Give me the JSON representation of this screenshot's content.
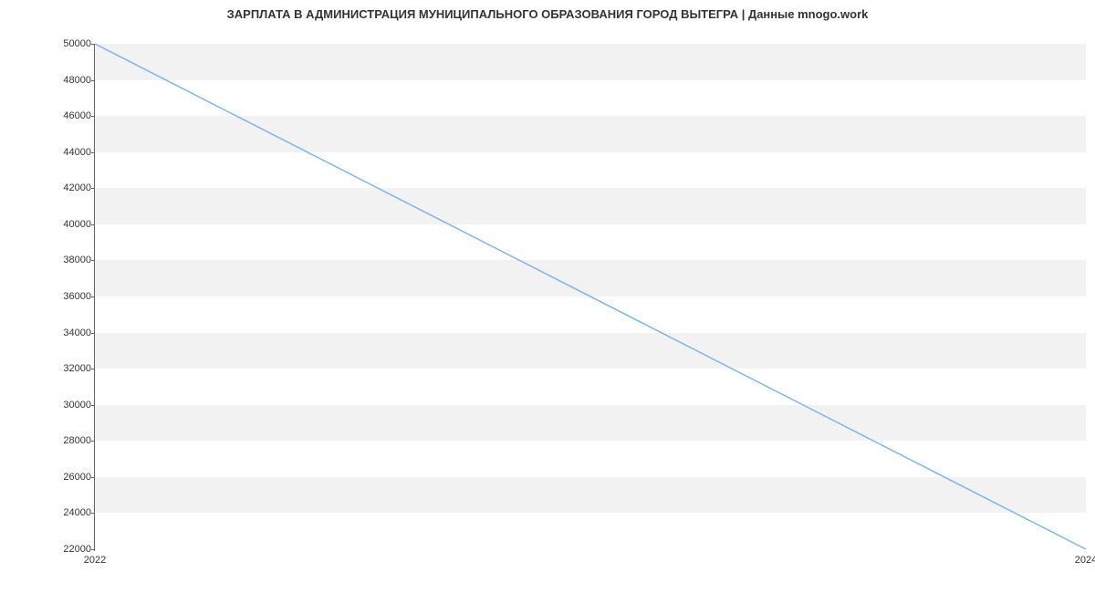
{
  "chart_data": {
    "type": "line",
    "title": "ЗАРПЛАТА В АДМИНИСТРАЦИЯ МУНИЦИПАЛЬНОГО ОБРАЗОВАНИЯ ГОРОД ВЫТЕГРА | Данные mnogo.work",
    "x": [
      2022,
      2024
    ],
    "values": [
      50000,
      22000
    ],
    "xlabel": "",
    "ylabel": "",
    "xlim": [
      2022,
      2024
    ],
    "ylim": [
      22000,
      50000
    ],
    "y_ticks": [
      22000,
      24000,
      26000,
      28000,
      30000,
      32000,
      34000,
      36000,
      38000,
      40000,
      42000,
      44000,
      46000,
      48000,
      50000
    ],
    "x_ticks": [
      2022,
      2024
    ],
    "line_color": "#7cb5ec",
    "band_color": "#f2f2f2"
  }
}
